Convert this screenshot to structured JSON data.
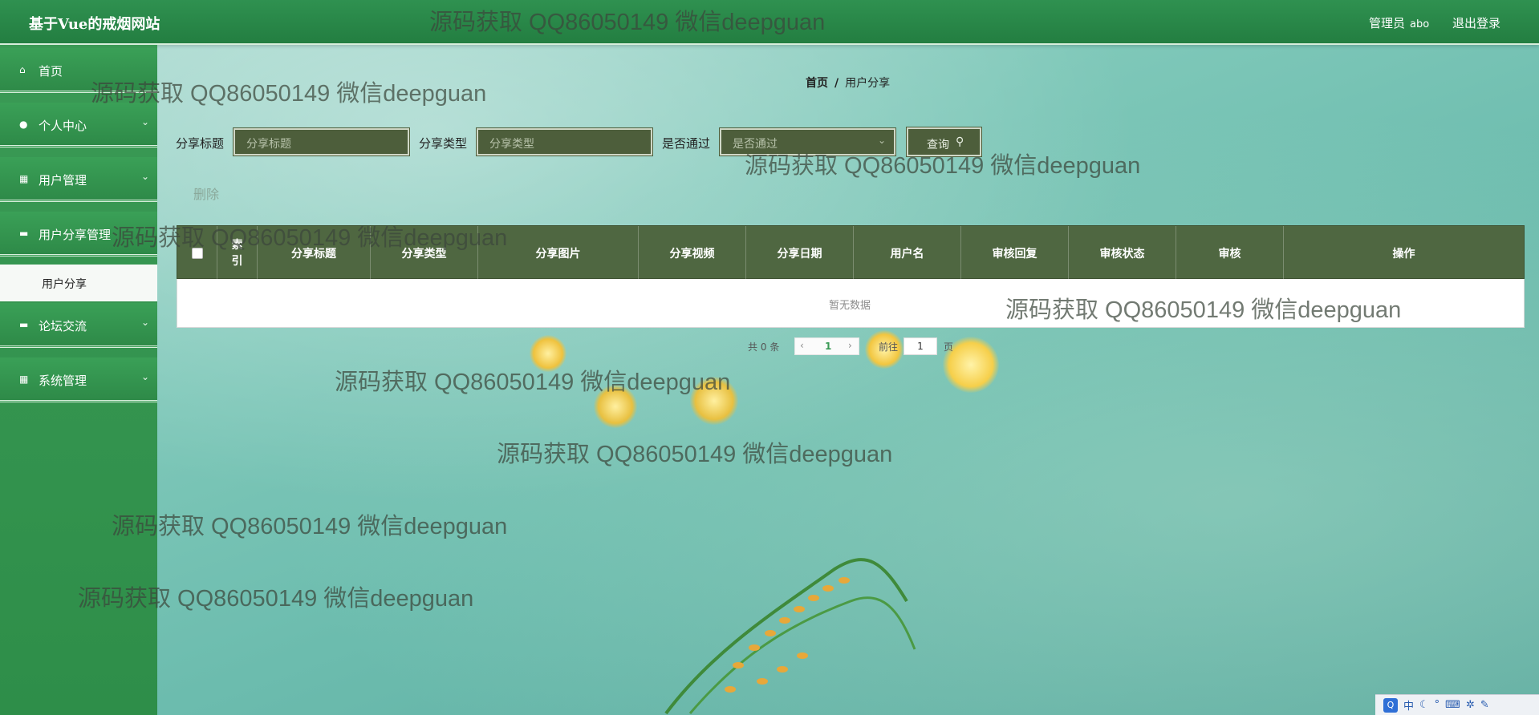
{
  "app": {
    "title": "基于Vue的戒烟网站"
  },
  "header": {
    "role": "管理员",
    "username": "abo",
    "logout": "退出登录"
  },
  "sidebar": {
    "items": [
      {
        "label": "首页",
        "icon": "home-icon"
      },
      {
        "label": "个人中心",
        "icon": "user-icon"
      },
      {
        "label": "用户管理",
        "icon": "grid-icon"
      },
      {
        "label": "用户分享管理",
        "icon": "laptop-icon"
      },
      {
        "label": "论坛交流",
        "icon": "laptop-icon"
      },
      {
        "label": "系统管理",
        "icon": "grid-icon"
      }
    ],
    "submenu_active": "用户分享"
  },
  "breadcrumb": {
    "home": "首页",
    "separator": "/",
    "current": "用户分享"
  },
  "filters": {
    "title": {
      "label": "分享标题",
      "placeholder": "分享标题"
    },
    "type": {
      "label": "分享类型",
      "placeholder": "分享类型"
    },
    "approved": {
      "label": "是否通过",
      "placeholder": "是否通过"
    },
    "query_label": "查询"
  },
  "actions": {
    "delete_label": "删除"
  },
  "table": {
    "columns": [
      "索引",
      "分享标题",
      "分享类型",
      "分享图片",
      "分享视频",
      "分享日期",
      "用户名",
      "审核回复",
      "审核状态",
      "审核",
      "操作"
    ],
    "empty_text": "暂无数据"
  },
  "pagination": {
    "total_prefix": "共",
    "total": "0",
    "total_suffix": "条",
    "current_page": "1",
    "goto_prefix": "前往",
    "goto_value": "1",
    "goto_suffix": "页"
  },
  "watermark": "源码获取 QQ86050149 微信deepguan",
  "tray": {
    "ime": "中"
  }
}
